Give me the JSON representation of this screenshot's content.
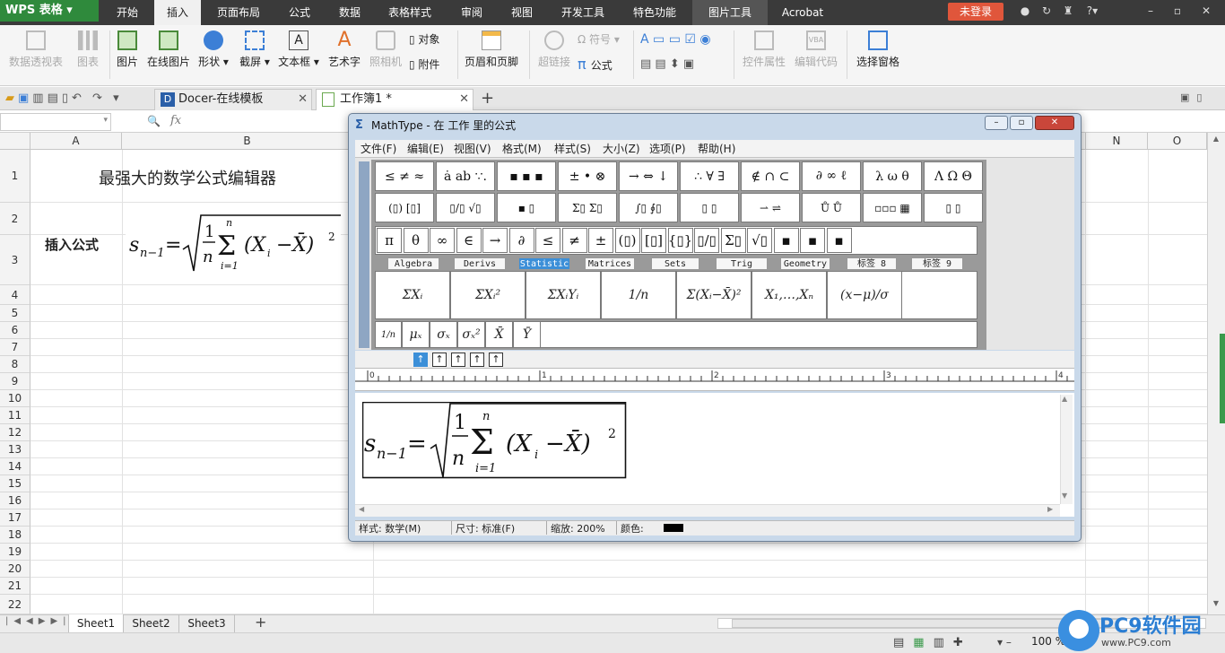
{
  "app": {
    "logo": "WPS 表格",
    "menu_tabs": [
      "开始",
      "插入",
      "页面布局",
      "公式",
      "数据",
      "表格样式",
      "审阅",
      "视图",
      "开发工具",
      "特色功能",
      "图片工具",
      "Acrobat"
    ],
    "active_tab": "插入",
    "login": "未登录",
    "help": "?"
  },
  "ribbon": {
    "pivot": "数据透视表",
    "chart": "图表",
    "picture": "图片",
    "online_picture": "在线图片",
    "shapes": "形状",
    "screenshot": "截屏",
    "textbox": "文本框",
    "wordart": "艺术字",
    "camera": "照相机",
    "object": "对象",
    "attachment": "附件",
    "header_footer": "页眉和页脚",
    "hyperlink": "超链接",
    "symbol": "符号",
    "formula": "公式",
    "control_props": "控件属性",
    "edit_code": "编辑代码",
    "selection_pane": "选择窗格"
  },
  "doc_tabs": [
    {
      "label": "Docer-在线模板"
    },
    {
      "label": "工作簿1 *"
    }
  ],
  "formula_bar": {
    "fx": "fx"
  },
  "grid": {
    "columns": [
      "A",
      "B",
      "N",
      "O"
    ],
    "rows": [
      "1",
      "2",
      "3",
      "4",
      "5",
      "6",
      "7",
      "8",
      "9",
      "10",
      "11",
      "12",
      "13",
      "14",
      "15",
      "16",
      "17",
      "18",
      "19",
      "20",
      "21",
      "22"
    ],
    "cell_b1": "最强大的数学公式编辑器",
    "cell_a2": "插入公式"
  },
  "sheets": [
    "Sheet1",
    "Sheet2",
    "Sheet3"
  ],
  "status": {
    "zoom": "100 %"
  },
  "mathtype": {
    "title": "MathType - 在 工作 里的公式",
    "menus": [
      "文件(F)",
      "编辑(E)",
      "视图(V)",
      "格式(M)",
      "样式(S)",
      "大小(Z)",
      "选项(P)",
      "帮助(H)"
    ],
    "palette_row1": [
      "≤ ≠ ≈",
      "ȧ ab ∵.",
      "▪ ▪ ▪",
      "± • ⊗",
      "→ ⇔ ↓",
      "∴ ∀ ∃",
      "∉ ∩ ⊂",
      "∂ ∞ ℓ",
      "λ ω θ",
      "Λ Ω Θ"
    ],
    "palette_row2": [
      "(▯) [▯]",
      "▯/▯ √▯",
      "▪ ▯",
      "Σ▯ Σ▯",
      "∫▯ ∮▯",
      "▯ ▯",
      "⇀ ⇌",
      "Ů Ů",
      "▫▫▫ ▦",
      "▯ ▯"
    ],
    "symbols": [
      "π",
      "θ",
      "∞",
      "∈",
      "→",
      "∂",
      "≤",
      "≠",
      "±",
      "(▯)",
      "[▯]",
      "{▯}",
      "▯/▯",
      "Σ▯",
      "√▯",
      "▪",
      "▪",
      "▪"
    ],
    "tabs": [
      "Algebra",
      "Derivs",
      "Statistic",
      "Matrices",
      "Sets",
      "Trig",
      "Geometry",
      "标签 8",
      "标签 9"
    ],
    "active_tab": "Statistic",
    "templates": [
      "ΣXᵢ",
      "ΣXᵢ²",
      "ΣXᵢYᵢ",
      "1/n",
      "Σ(Xᵢ−X̄)²",
      "X₁,…,Xₙ",
      "(x−μ)/σ"
    ],
    "small_templates": [
      "1/n",
      "μₓ",
      "σₓ",
      "σₓ²",
      "X̄",
      "Ȳ"
    ],
    "ruler_labels": [
      "0",
      "1",
      "2",
      "3",
      "4"
    ],
    "status": {
      "style": "样式: 数学(M)",
      "size": "尺寸: 标准(F)",
      "zoom": "缩放: 200%",
      "color": "颜色:"
    }
  },
  "watermark": {
    "brand": "PC9软件园",
    "url": "www.PC9.com"
  }
}
